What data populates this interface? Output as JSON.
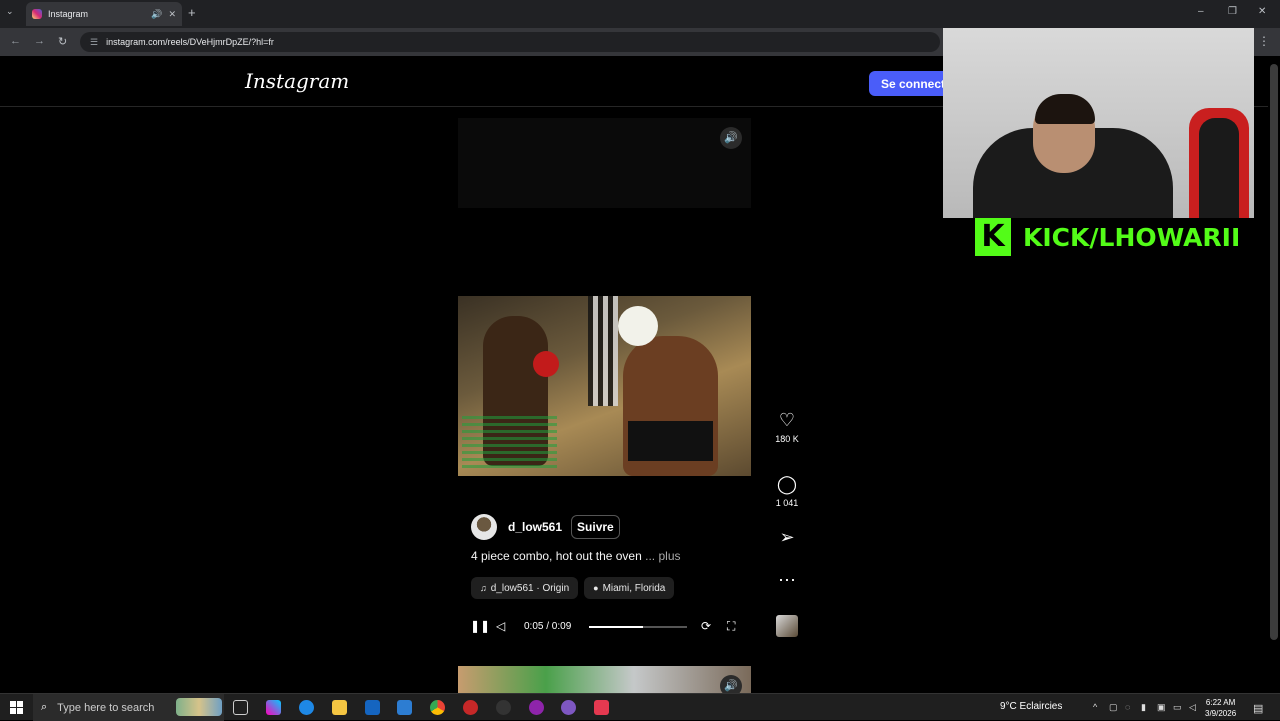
{
  "browser": {
    "tab_title": "Instagram",
    "tab_audio_icon": "speaker-icon",
    "tab_close": "✕",
    "new_tab": "+",
    "url": "instagram.com/reels/DVeHjmrDpZE/?hl=fr",
    "window_controls": [
      "–",
      "❐",
      "✕"
    ]
  },
  "instagram": {
    "logo": "Instagram",
    "login_label": "Se connecter",
    "login_color": "#4a5df9",
    "reel": {
      "username": "d_low561",
      "follow_label": "Suivre",
      "caption": "4 piece combo, hot out the oven",
      "caption_more": "... plus",
      "audio_chip": "d_low561 · Origin",
      "location_chip": "Miami, Florida",
      "time": "0:05 / 0:09",
      "progress_fraction": 0.55
    },
    "actions": {
      "likes": "180 K",
      "comments": "1 041"
    }
  },
  "stream_overlay": {
    "kick_logo": "K",
    "kick_text": "KICK/LHOWARII",
    "kick_color": "#53fc18"
  },
  "taskbar": {
    "search_placeholder": "Type here to search",
    "weather": "9°C  Eclaircies",
    "time": "6:22 AM",
    "date": "3/9/2026"
  }
}
